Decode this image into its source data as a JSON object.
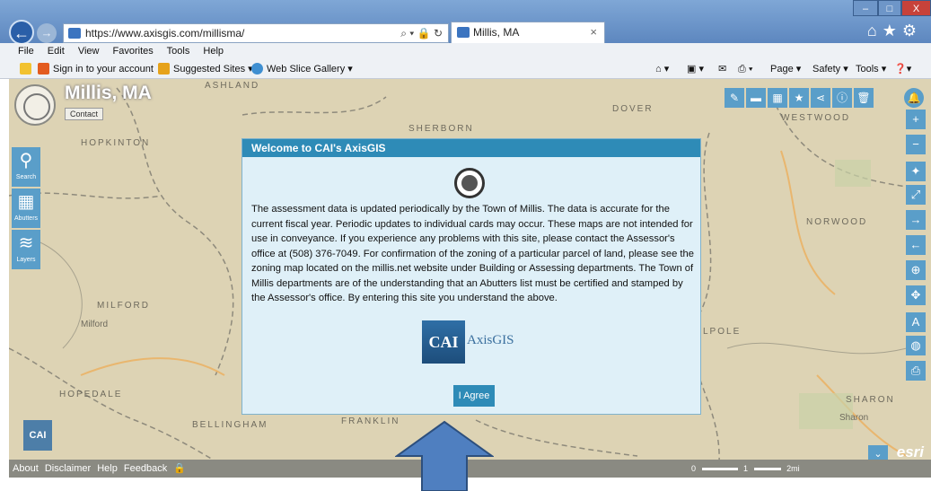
{
  "browser": {
    "url": "https://www.axisgis.com/millisma/",
    "tab_title": "Millis, MA",
    "window_controls": [
      "–",
      "□",
      "X"
    ],
    "menu": [
      "File",
      "Edit",
      "View",
      "Favorites",
      "Tools",
      "Help"
    ],
    "favorites": {
      "sign_in": "Sign in to your account",
      "suggested_sites": "Suggested Sites ▾",
      "web_slice": "Web Slice Gallery ▾"
    },
    "command_bar": {
      "page": "Page ▾",
      "safety": "Safety ▾",
      "tools": "Tools ▾"
    }
  },
  "map": {
    "town_title": "Millis, MA",
    "contact_label": "Contact",
    "place_labels": [
      "ASHLAND",
      "DOVER",
      "WESTWOOD",
      "HOPKINTON",
      "SHERBORN",
      "NORWOOD",
      "MILFORD",
      "Milford",
      "HOPEDALE",
      "BELLINGHAM",
      "FRANKLIN",
      "SHARON",
      "Sharon",
      "LPOLE"
    ],
    "left_tools": [
      "Search",
      "Abutters",
      "Layers"
    ],
    "esri_label": "esri",
    "cai_small": "CAI"
  },
  "statusbar": {
    "links": [
      "About",
      "Disclaimer",
      "Help",
      "Feedback"
    ],
    "scale_labels": [
      "0",
      "1",
      "2mi"
    ]
  },
  "modal": {
    "title": "Welcome to CAI's AxisGIS",
    "body": "The assessment data is updated periodically by the Town of Millis. The data is accurate for the current fiscal year. Periodic updates to individual cards may occur. These maps are not intended for use in conveyance. If you experience any problems with this site, please contact the Assessor's office at (508) 376-7049. For confirmation of the zoning of a particular parcel of land, please see the zoning map located on the millis.net website under Building or Assessing departments. The Town of Millis departments are of the understanding that an Abutters list must be certified and stamped by the Assessor's office. By entering this site you understand the above.",
    "logo_box": "CAI",
    "logo_text": "AxisGIS",
    "agree_label": "I Agree"
  },
  "colors": {
    "accent": "#2e8bb7",
    "tool_blue": "#5a9ec9",
    "modal_bg": "#dff0f8",
    "arrow_fill": "#4f7fc0"
  }
}
